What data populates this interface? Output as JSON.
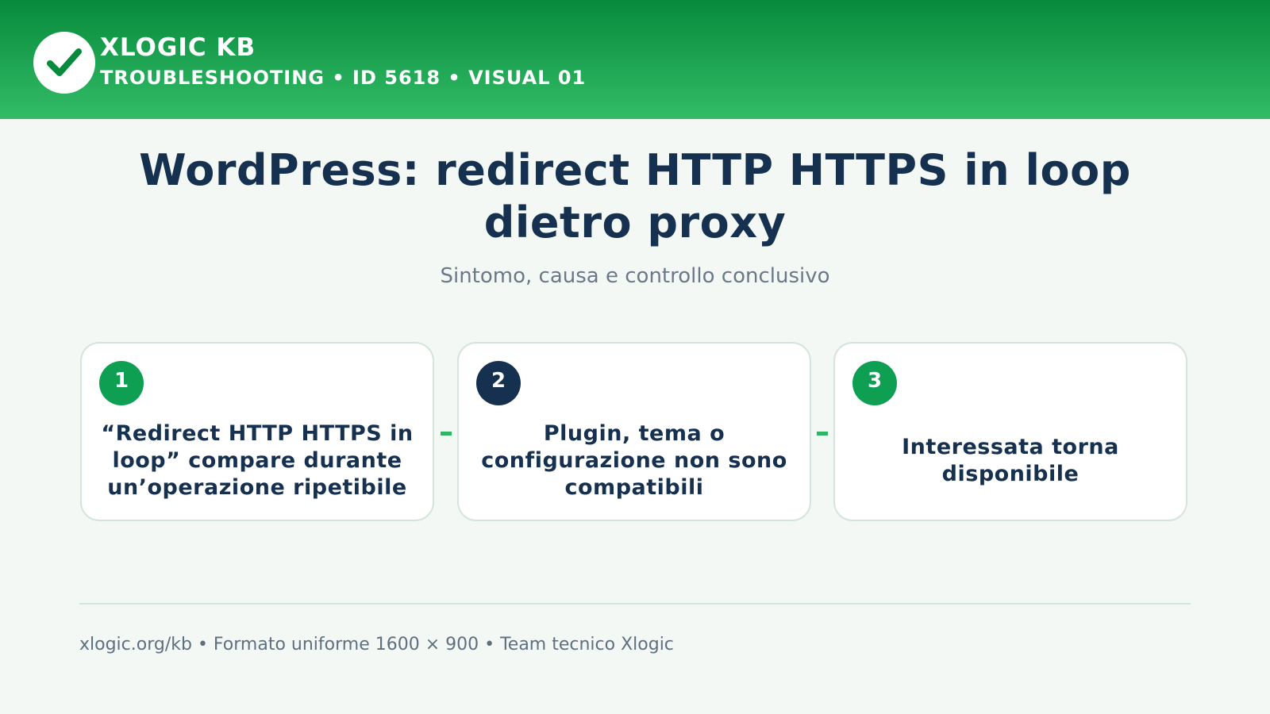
{
  "header": {
    "logo_icon": "checkmark-icon",
    "brand": "XLOGIC KB",
    "subtitle": "TROUBLESHOOTING • ID 5618 • VISUAL 01"
  },
  "title": "WordPress: redirect HTTP HTTPS in loop dietro proxy",
  "subtitle": "Sintomo, causa e controllo conclusivo",
  "steps": [
    {
      "number": "1",
      "text": "“Redirect HTTP HTTPS in loop” compare durante un’operazione ripetibile",
      "badge_color": "#0f9f53"
    },
    {
      "number": "2",
      "text": "Plugin, tema o configurazione non sono compatibili",
      "badge_color": "#16304f"
    },
    {
      "number": "3",
      "text": "Interessata torna disponibile",
      "badge_color": "#0f9f53"
    }
  ],
  "footer": "xlogic.org/kb • Formato uniforme 1600 × 900 • Team tecnico Xlogic",
  "colors": {
    "header_top": "#078a3c",
    "header_bottom": "#33bc67",
    "title": "#16304f",
    "accent": "#2fb566"
  }
}
